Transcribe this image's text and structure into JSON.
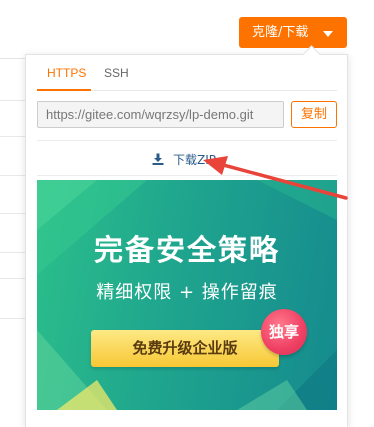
{
  "clone_button": {
    "label": "克隆/下载"
  },
  "clone_panel": {
    "tabs": [
      {
        "label": "HTTPS",
        "active": true
      },
      {
        "label": "SSH",
        "active": false
      }
    ],
    "url_value": "https://gitee.com/wqrzsy/lp-demo.git",
    "copy_label": "复制",
    "download_zip_label": "下载ZIP"
  },
  "promo_banner": {
    "title": "完备安全策略",
    "subtitle": "精细权限 + 操作留痕",
    "cta_label": "免费升级企业版",
    "badge_label": "独享"
  },
  "colors": {
    "accent": "#fe7300",
    "link": "#2a5c8a",
    "annotation": "#e8443a",
    "banner_green": "#1fa58e"
  }
}
